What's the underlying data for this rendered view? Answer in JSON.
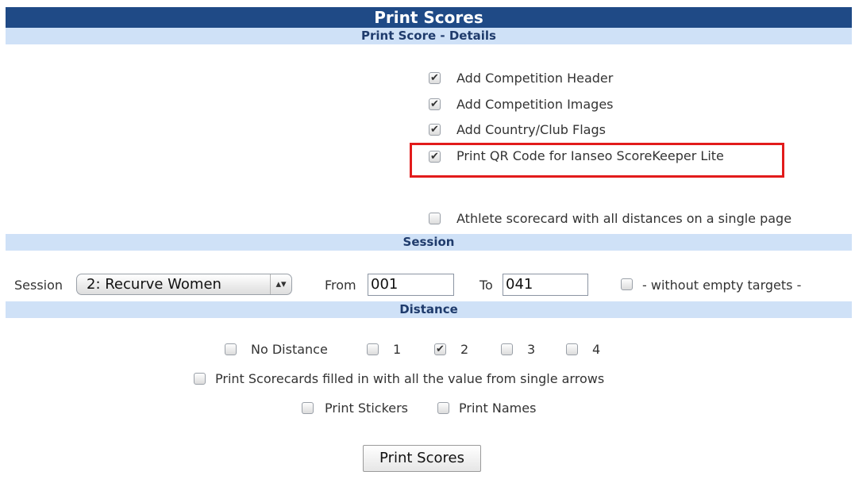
{
  "header": {
    "title": "Print Scores"
  },
  "details": {
    "heading": "Print Score - Details",
    "options": [
      {
        "label": "Add Competition Header",
        "checked": true
      },
      {
        "label": "Add Competition Images",
        "checked": true
      },
      {
        "label": "Add Country/Club Flags",
        "checked": true
      },
      {
        "label": "Print QR Code for Ianseo ScoreKeeper Lite",
        "checked": true
      },
      {
        "label": "Athlete scorecard with all distances on a single page",
        "checked": false
      }
    ]
  },
  "session": {
    "heading": "Session",
    "label": "Session",
    "selected": "2: Recurve Women",
    "from_label": "From",
    "from_value": "001",
    "to_label": "To",
    "to_value": "041",
    "without_empty_label": "- without empty targets -",
    "without_empty_checked": false
  },
  "distance": {
    "heading": "Distance",
    "options": [
      {
        "label": "No Distance",
        "checked": false
      },
      {
        "label": "1",
        "checked": false
      },
      {
        "label": "2",
        "checked": true
      },
      {
        "label": "3",
        "checked": false
      },
      {
        "label": "4",
        "checked": false
      }
    ],
    "single_arrows_label": "Print Scorecards filled in with all the value from single arrows",
    "single_arrows_checked": false,
    "stickers_label": "Print Stickers",
    "stickers_checked": false,
    "names_label": "Print Names",
    "names_checked": false
  },
  "actions": {
    "print_button": "Print Scores"
  },
  "colors": {
    "title_bg": "#1f4a86",
    "section_bg": "#cfe1f7",
    "highlight": "#e21b1b"
  }
}
